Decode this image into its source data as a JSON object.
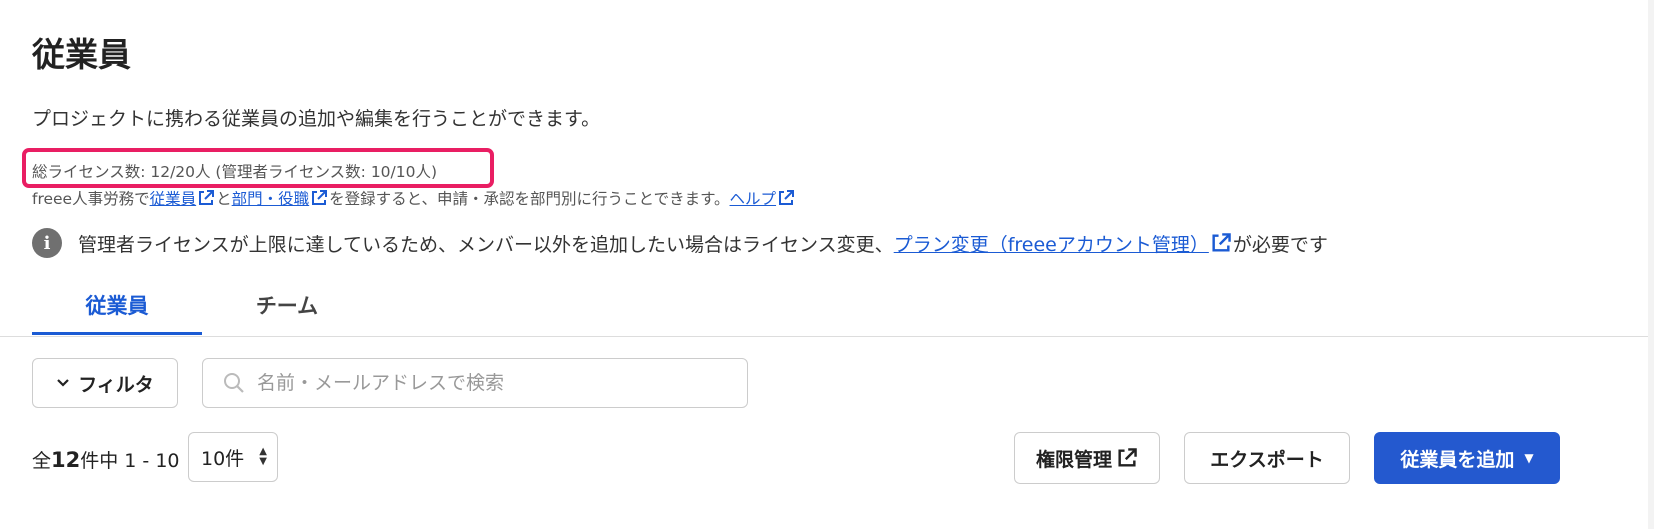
{
  "page": {
    "title": "従業員",
    "description": "プロジェクトに携わる従業員の追加や編集を行うことができます。"
  },
  "license": {
    "text": "総ライセンス数: 12/20人 (管理者ライセンス数: 10/10人)"
  },
  "hr_info": {
    "prefix": "freee人事労務で",
    "link_employees": "従業員",
    "connector": "と",
    "link_departments": "部門・役職",
    "middle": "を登録すると、申請・承認を部門別に行うことできます。",
    "link_help": "ヘルプ"
  },
  "notice": {
    "icon": "info-icon",
    "text_before": "管理者ライセンスが上限に達しているため、メンバー以外を追加したい場合はライセンス変更、",
    "link_text": "プラン変更（freeeアカウント管理）",
    "text_after": "が必要です"
  },
  "tabs": [
    {
      "label": "従業員",
      "active": true
    },
    {
      "label": "チーム",
      "active": false
    }
  ],
  "toolbar": {
    "filter_label": "フィルタ",
    "search_placeholder": "名前・メールアドレスで検索"
  },
  "pagination": {
    "prefix": "全",
    "total": "12",
    "suffix": "件中 1 - 10",
    "per_page": "10件"
  },
  "actions": {
    "permissions_label": "権限管理",
    "export_label": "エクスポート",
    "add_label": "従業員を追加"
  },
  "colors": {
    "accent": "#1b5bd4",
    "primary_button": "#2459cf",
    "highlight_border": "#e91e63"
  }
}
